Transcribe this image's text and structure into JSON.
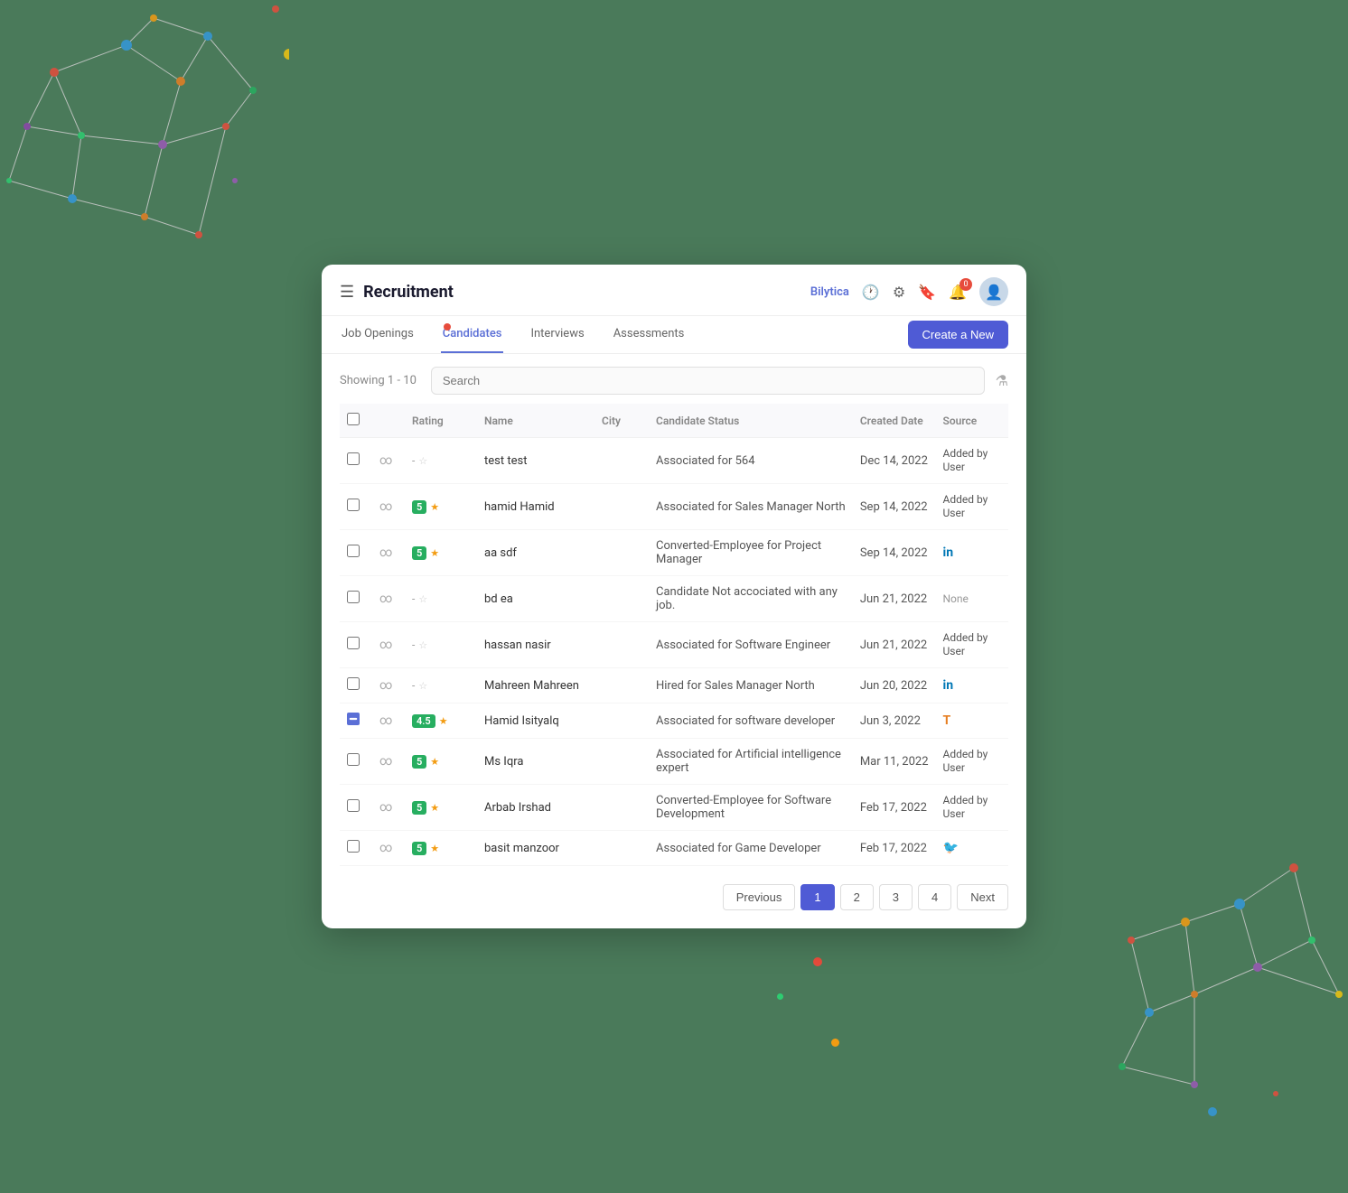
{
  "header": {
    "menu_icon": "☰",
    "app_title": "Recruitment",
    "brand_name": "Bilytica",
    "notification_count": "0",
    "avatar_icon": "👤"
  },
  "nav": {
    "tabs": [
      {
        "id": "job-openings",
        "label": "Job Openings",
        "active": false
      },
      {
        "id": "candidates",
        "label": "Candidates",
        "active": true
      },
      {
        "id": "interviews",
        "label": "Interviews",
        "active": false
      },
      {
        "id": "assessments",
        "label": "Assessments",
        "active": false
      }
    ],
    "create_button": "Create a New"
  },
  "toolbar": {
    "showing_text": "Showing 1 - 10",
    "search_placeholder": "Search",
    "filter_icon": "⚗"
  },
  "table": {
    "columns": [
      "",
      "",
      "Rating",
      "Name",
      "City",
      "Candidate Status",
      "Created Date",
      "Source"
    ],
    "rows": [
      {
        "rating": "-☆",
        "rating_type": "dash",
        "name": "test test",
        "city": "",
        "status": "Associated for 564",
        "date": "Dec 14, 2022",
        "source": "Added by User",
        "source_type": "text"
      },
      {
        "rating": "5★",
        "rating_type": "num",
        "name": "hamid Hamid",
        "city": "",
        "status": "Associated for Sales Manager North",
        "date": "Sep 14, 2022",
        "source": "Added by User",
        "source_type": "text"
      },
      {
        "rating": "5★",
        "rating_type": "num",
        "name": "aa sdf",
        "city": "",
        "status": "Converted-Employee for Project Manager",
        "date": "Sep 14, 2022",
        "source": "in",
        "source_type": "linkedin"
      },
      {
        "rating": "-☆",
        "rating_type": "dash",
        "name": "bd ea",
        "city": "",
        "status": "Candidate Not accociated with any job.",
        "date": "Jun 21, 2022",
        "source": "None",
        "source_type": "none"
      },
      {
        "rating": "-☆",
        "rating_type": "dash",
        "name": "hassan nasir",
        "city": "",
        "status": "Associated for Software Engineer",
        "date": "Jun 21, 2022",
        "source": "Added by User",
        "source_type": "text"
      },
      {
        "rating": "-☆",
        "rating_type": "dash",
        "name": "Mahreen Mahreen",
        "city": "",
        "status": "Hired for Sales Manager North",
        "date": "Jun 20, 2022",
        "source": "in",
        "source_type": "linkedin"
      },
      {
        "rating": "4.5★",
        "rating_type": "num45",
        "name": "Hamid Isityalq",
        "city": "",
        "status": "Associated for software developer",
        "date": "Jun 3, 2022",
        "source": "T",
        "source_type": "taleo"
      },
      {
        "rating": "5★",
        "rating_type": "num",
        "name": "Ms Iqra",
        "city": "",
        "status": "Associated for Artificial intelligence expert",
        "date": "Mar 11, 2022",
        "source": "Added by User",
        "source_type": "text"
      },
      {
        "rating": "5★",
        "rating_type": "num",
        "name": "Arbab Irshad",
        "city": "",
        "status": "Converted-Employee for Software Development",
        "date": "Feb 17, 2022",
        "source": "Added by User",
        "source_type": "text"
      },
      {
        "rating": "5★",
        "rating_type": "num",
        "name": "basit manzoor",
        "city": "",
        "status": "Associated for Game Developer",
        "date": "Feb 17, 2022",
        "source": "🐦",
        "source_type": "twitter"
      }
    ]
  },
  "pagination": {
    "previous": "Previous",
    "next": "Next",
    "pages": [
      "1",
      "2",
      "3",
      "4"
    ],
    "active_page": "1"
  }
}
